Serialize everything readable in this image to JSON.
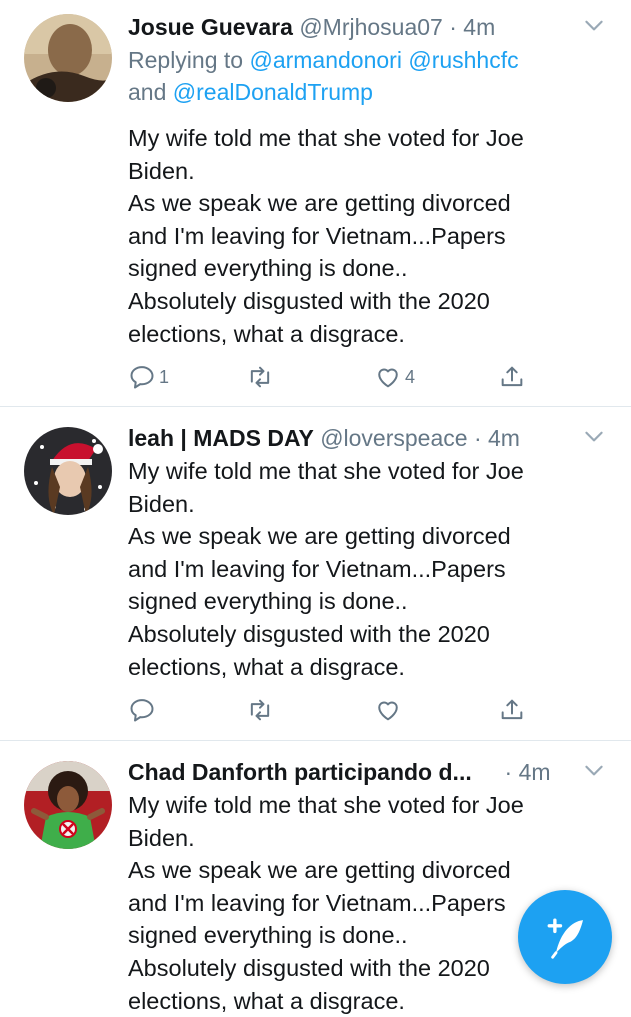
{
  "tweets": [
    {
      "name": "Josue Guevara",
      "handle": "@Mrjhosua07",
      "dot": "·",
      "time": "4m",
      "replying_prefix": "Replying to",
      "reply_mentions": [
        "@armandonori",
        "@rushhcfc"
      ],
      "reply_and": "and",
      "reply_last": "@realDonaldTrump",
      "body": "My wife told me that she voted for Joe\nBiden.\nAs we speak we are getting divorced\nand I'm leaving for Vietnam...Papers\nsigned everything is done..\nAbsolutely disgusted with the 2020\nelections, what a disgrace.",
      "reply_count": "1",
      "like_count": "4"
    },
    {
      "name": "leah | MADS DAY",
      "handle": "@loverspeace",
      "dot": "·",
      "time": "4m",
      "body": "My wife told me that she voted for Joe\nBiden.\nAs we speak we are getting divorced\nand I'm leaving for Vietnam...Papers\nsigned everything is done..\nAbsolutely disgusted with the 2020\nelections, what a disgrace."
    },
    {
      "name": "Chad Danforth participando d...",
      "dot": "·",
      "time": "4m",
      "body": "My wife told me that she voted for Joe\nBiden.\nAs we speak we are getting divorced\nand I'm leaving for Vietnam...Papers\nsigned everything is done..\nAbsolutely disgusted with the 2020\nelections, what a disgrace."
    }
  ],
  "icons": {
    "reply": "reply-icon",
    "retweet": "retweet-icon",
    "like": "heart-icon",
    "share": "share-icon",
    "menu": "chevron-down-icon",
    "compose": "compose-tweet-icon"
  },
  "colors": {
    "accent": "#1da1f2",
    "secondary_text": "#657786",
    "divider": "#e1e8ed"
  }
}
